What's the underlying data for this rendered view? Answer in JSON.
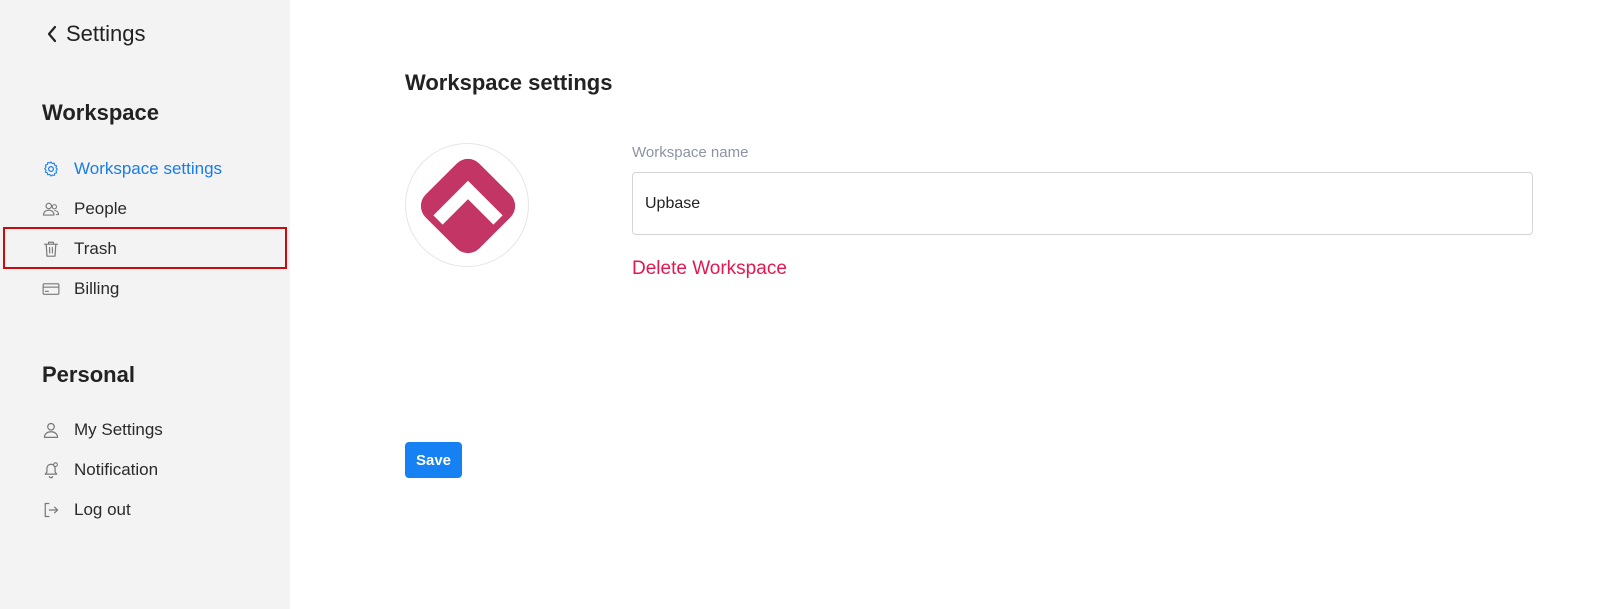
{
  "header": {
    "back_label": "Settings"
  },
  "sidebar": {
    "workspace_title": "Workspace",
    "workspace_items": [
      {
        "label": "Workspace settings",
        "icon": "gear-icon",
        "active": true
      },
      {
        "label": "People",
        "icon": "people-icon",
        "active": false
      },
      {
        "label": "Trash",
        "icon": "trash-icon",
        "active": false,
        "highlighted": true
      },
      {
        "label": "Billing",
        "icon": "credit-card-icon",
        "active": false
      }
    ],
    "personal_title": "Personal",
    "personal_items": [
      {
        "label": "My Settings",
        "icon": "user-icon"
      },
      {
        "label": "Notification",
        "icon": "bell-icon"
      },
      {
        "label": "Log out",
        "icon": "logout-icon"
      }
    ]
  },
  "main": {
    "title": "Workspace settings",
    "logo_icon": "upbase-logo-icon",
    "name_field": {
      "label": "Workspace name",
      "value": "Upbase"
    },
    "delete_label": "Delete Workspace",
    "save_label": "Save"
  },
  "colors": {
    "accent": "#1a7ce8",
    "danger": "#e5174f",
    "logo": "#c23564",
    "highlight": "#c90b0b",
    "sidebar_bg": "#f3f3f3"
  }
}
